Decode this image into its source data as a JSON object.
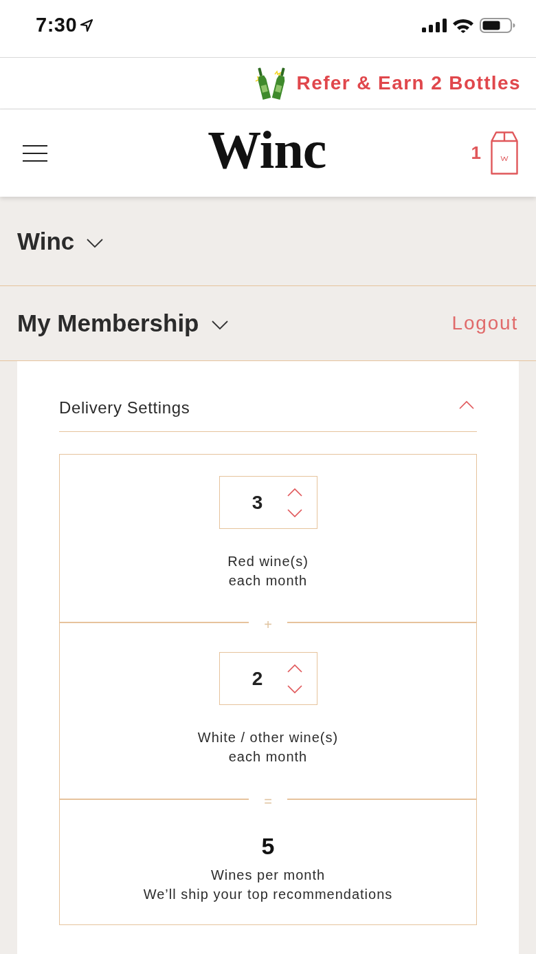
{
  "status_bar": {
    "time": "7:30"
  },
  "promo_banner": {
    "text": "Refer & Earn 2 Bottles"
  },
  "header": {
    "logo": "Winc",
    "cart_count": "1"
  },
  "menus": [
    {
      "title": "Winc",
      "expanded": false
    },
    {
      "title": "My Membership",
      "expanded": false,
      "link": "Logout"
    }
  ],
  "delivery_settings": {
    "title": "Delivery Settings",
    "expanded": true,
    "operators": [
      "+",
      "="
    ],
    "rows": [
      {
        "kind": "stepper",
        "value": "3",
        "label_lines": [
          "Red wine(s)",
          "each month"
        ]
      },
      {
        "kind": "stepper",
        "value": "2",
        "label_lines": [
          "White / other wine(s)",
          "each month"
        ]
      },
      {
        "kind": "total",
        "value": "5",
        "label": "Wines per month",
        "note": "We’ll ship your top recommendations"
      }
    ]
  }
}
